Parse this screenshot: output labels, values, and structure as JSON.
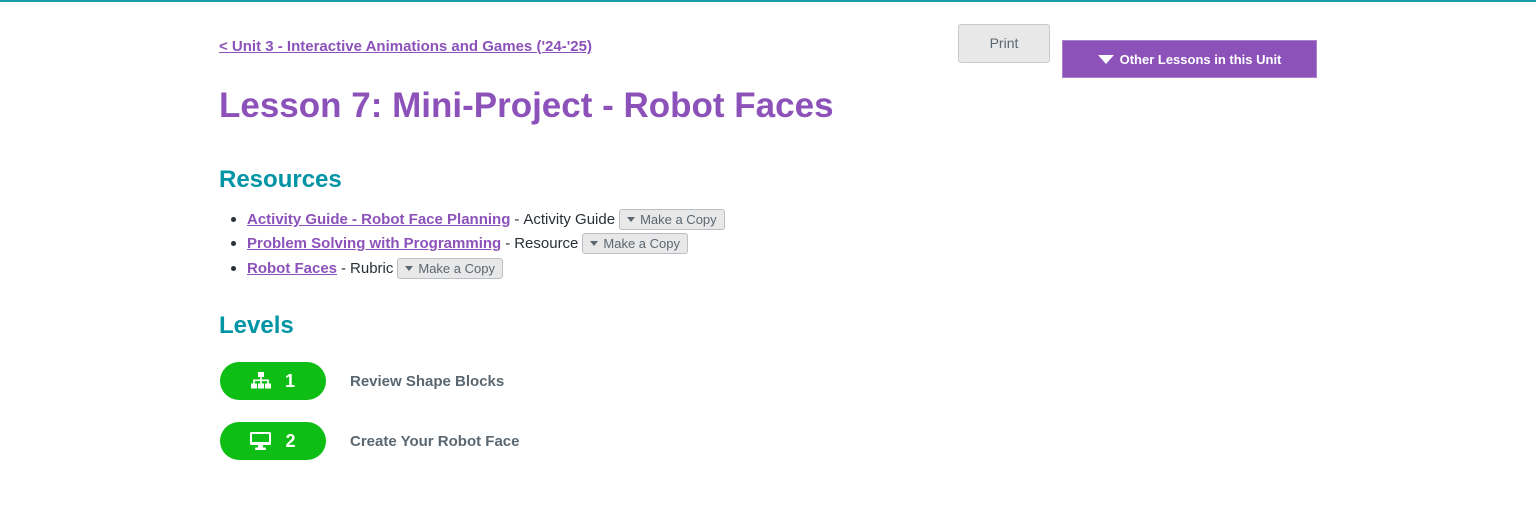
{
  "header": {
    "back_link": "< Unit 3 - Interactive Animations and Games ('24-'25)",
    "print_label": "Print",
    "other_lessons_label": "Other Lessons in this Unit"
  },
  "lesson": {
    "title": "Lesson 7: Mini-Project - Robot Faces"
  },
  "resources": {
    "heading": "Resources",
    "items": [
      {
        "link": "Activity Guide - Robot Face Planning",
        "separator": "-",
        "type": "Activity Guide",
        "copy_label": "Make a Copy"
      },
      {
        "link": "Problem Solving with Programming",
        "separator": "-",
        "type": "Resource",
        "copy_label": "Make a Copy"
      },
      {
        "link": "Robot Faces",
        "separator": "-",
        "type": "Rubric",
        "copy_label": "Make a Copy"
      }
    ]
  },
  "levels": {
    "heading": "Levels",
    "items": [
      {
        "number": "1",
        "icon": "sitemap-icon",
        "name": "Review Shape Blocks"
      },
      {
        "number": "2",
        "icon": "desktop-icon",
        "name": "Create Your Robot Face"
      }
    ]
  },
  "colors": {
    "accent_purple": "#8c52ba",
    "heading_teal": "#0094a5",
    "level_green": "#0fbe14",
    "top_line": "#1a9ea6"
  }
}
